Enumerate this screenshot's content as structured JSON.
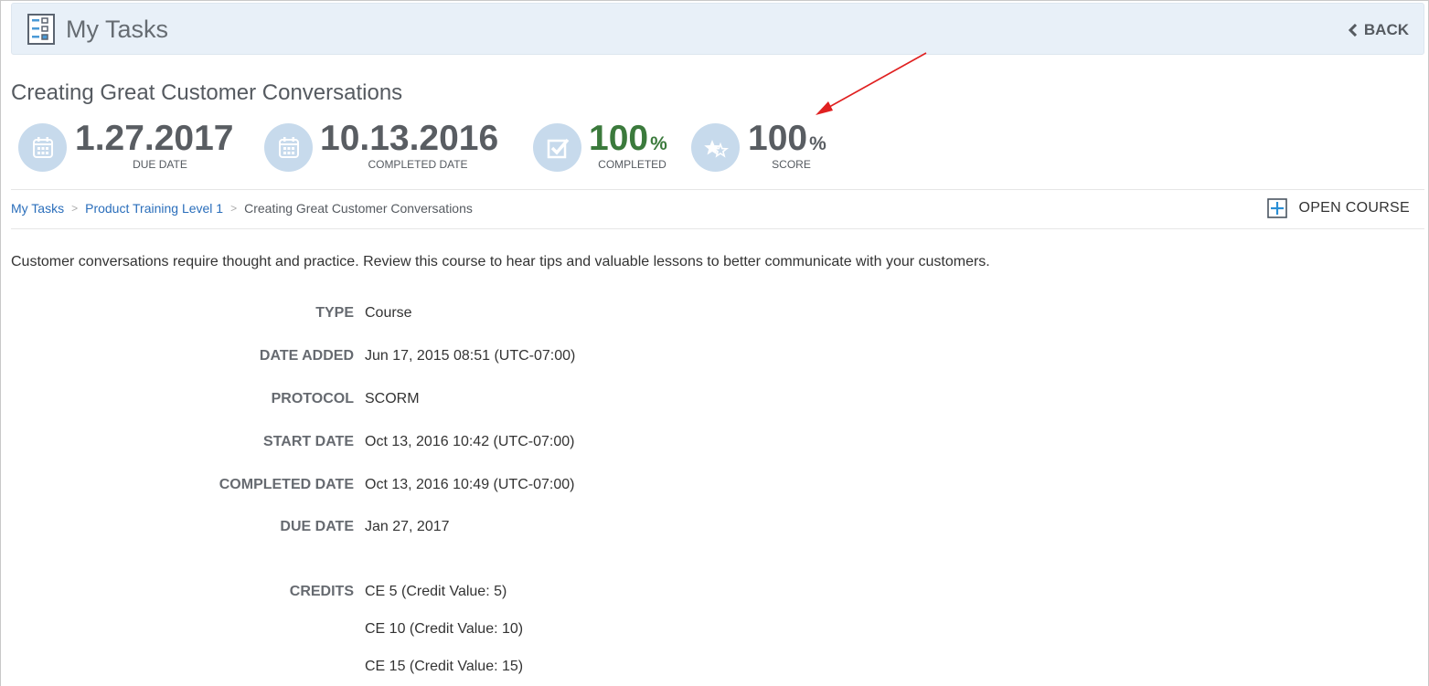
{
  "header": {
    "title": "My Tasks",
    "back_label": "BACK",
    "app_icon": "task-list-icon"
  },
  "course": {
    "title": "Creating Great Customer Conversations",
    "description": "Customer conversations require thought and practice. Review this course to hear tips and valuable lessons to better communicate with your customers."
  },
  "stats": {
    "due_date": {
      "value": "1.27.2017",
      "label": "DUE DATE",
      "icon": "calendar-icon"
    },
    "completed_date": {
      "value": "10.13.2016",
      "label": "COMPLETED DATE",
      "icon": "calendar-icon"
    },
    "completed": {
      "value": "100",
      "unit": "%",
      "label": "COMPLETED",
      "icon": "checkbox-icon",
      "color": "#3b7a3c"
    },
    "score": {
      "value": "100",
      "unit": "%",
      "label": "SCORE",
      "icon": "stars-icon"
    }
  },
  "breadcrumb": {
    "items": [
      "My Tasks",
      "Product Training Level 1"
    ],
    "separator": ">",
    "current": "Creating Great Customer Conversations"
  },
  "open_course_label": "OPEN COURSE",
  "details": {
    "type": {
      "label": "TYPE",
      "value": "Course"
    },
    "date_added": {
      "label": "DATE ADDED",
      "value": "Jun 17, 2015 08:51 (UTC-07:00)"
    },
    "protocol": {
      "label": "PROTOCOL",
      "value": "SCORM"
    },
    "start_date": {
      "label": "START DATE",
      "value": "Oct 13, 2016 10:42 (UTC-07:00)"
    },
    "completed_date": {
      "label": "COMPLETED DATE",
      "value": "Oct 13, 2016 10:49 (UTC-07:00)"
    },
    "due_date": {
      "label": "DUE DATE",
      "value": "Jan 27, 2017"
    },
    "credits": {
      "label": "CREDITS",
      "values": [
        "CE 5 (Credit Value: 5)",
        "CE 10 (Credit Value: 10)",
        "CE 15 (Credit Value: 15)"
      ]
    }
  },
  "colors": {
    "accent_link": "#2a6ebb",
    "header_bg": "#e8f0f8",
    "icon_circle": "#c7daec",
    "annotation_arrow": "#e02020"
  }
}
